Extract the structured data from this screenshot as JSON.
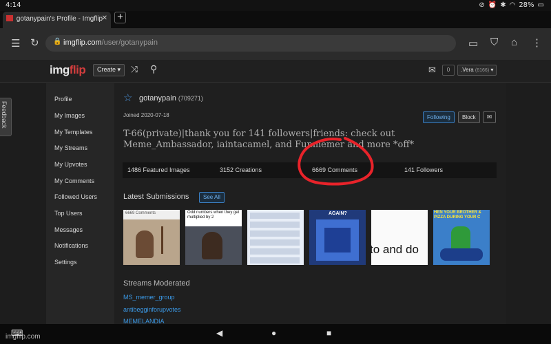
{
  "status_bar": {
    "time": "4:14",
    "battery": "28%"
  },
  "browser": {
    "tab_title": "gotanypain's Profile - Imgflip",
    "url_host": "imgflip.com",
    "url_path": "/user/gotanypain"
  },
  "site_header": {
    "logo_img": "img",
    "logo_flip": "flip",
    "create_label": "Create ▾",
    "notif_count": "0",
    "user_label": ".Vera",
    "user_points": "(6166)"
  },
  "feedback_label": "Feedback",
  "sidebar": {
    "items": [
      {
        "label": "Profile"
      },
      {
        "label": "My Images"
      },
      {
        "label": "My Templates"
      },
      {
        "label": "My Streams"
      },
      {
        "label": "My Upvotes"
      },
      {
        "label": "My Comments"
      },
      {
        "label": "Followed Users"
      },
      {
        "label": "Top Users"
      },
      {
        "label": "Messages"
      },
      {
        "label": "Notifications"
      },
      {
        "label": "Settings"
      }
    ]
  },
  "profile": {
    "username": "gotanypain",
    "points": "(709271)",
    "joined": "Joined 2020-07-18",
    "following_label": "Following",
    "block_label": "Block",
    "bio": "T-66(private)|thank you for 141 followers|friends: check out Meme_Ambassador, iaintacamel, and Funmemer and more *off*",
    "stats": [
      {
        "label": "1486 Featured Images"
      },
      {
        "label": "3152 Creations"
      },
      {
        "label": "6669 Comments"
      },
      {
        "label": "141 Followers"
      }
    ]
  },
  "latest": {
    "title": "Latest Submissions",
    "see_all": "See All",
    "thumbs": [
      {
        "caption": "6669 Comments"
      },
      {
        "caption": "Odd numbers when they get multiplied by 2"
      },
      {
        "caption": ""
      },
      {
        "caption": "AGAIN?"
      },
      {
        "caption": "to and do"
      },
      {
        "caption": "HEN YOUR BROTHER & PIZZA DURING YOUR C"
      }
    ]
  },
  "streams_moderated": {
    "title": "Streams Moderated",
    "links": [
      {
        "label": "MS_memer_group"
      },
      {
        "label": "antibegginforupvotes"
      },
      {
        "label": "MEMELANDIA"
      }
    ]
  },
  "watermark": "imgflip.com",
  "colors": {
    "accent_blue": "#3b9ae8",
    "logo_red": "#d23d3d",
    "annotation_red": "#e8232a"
  }
}
